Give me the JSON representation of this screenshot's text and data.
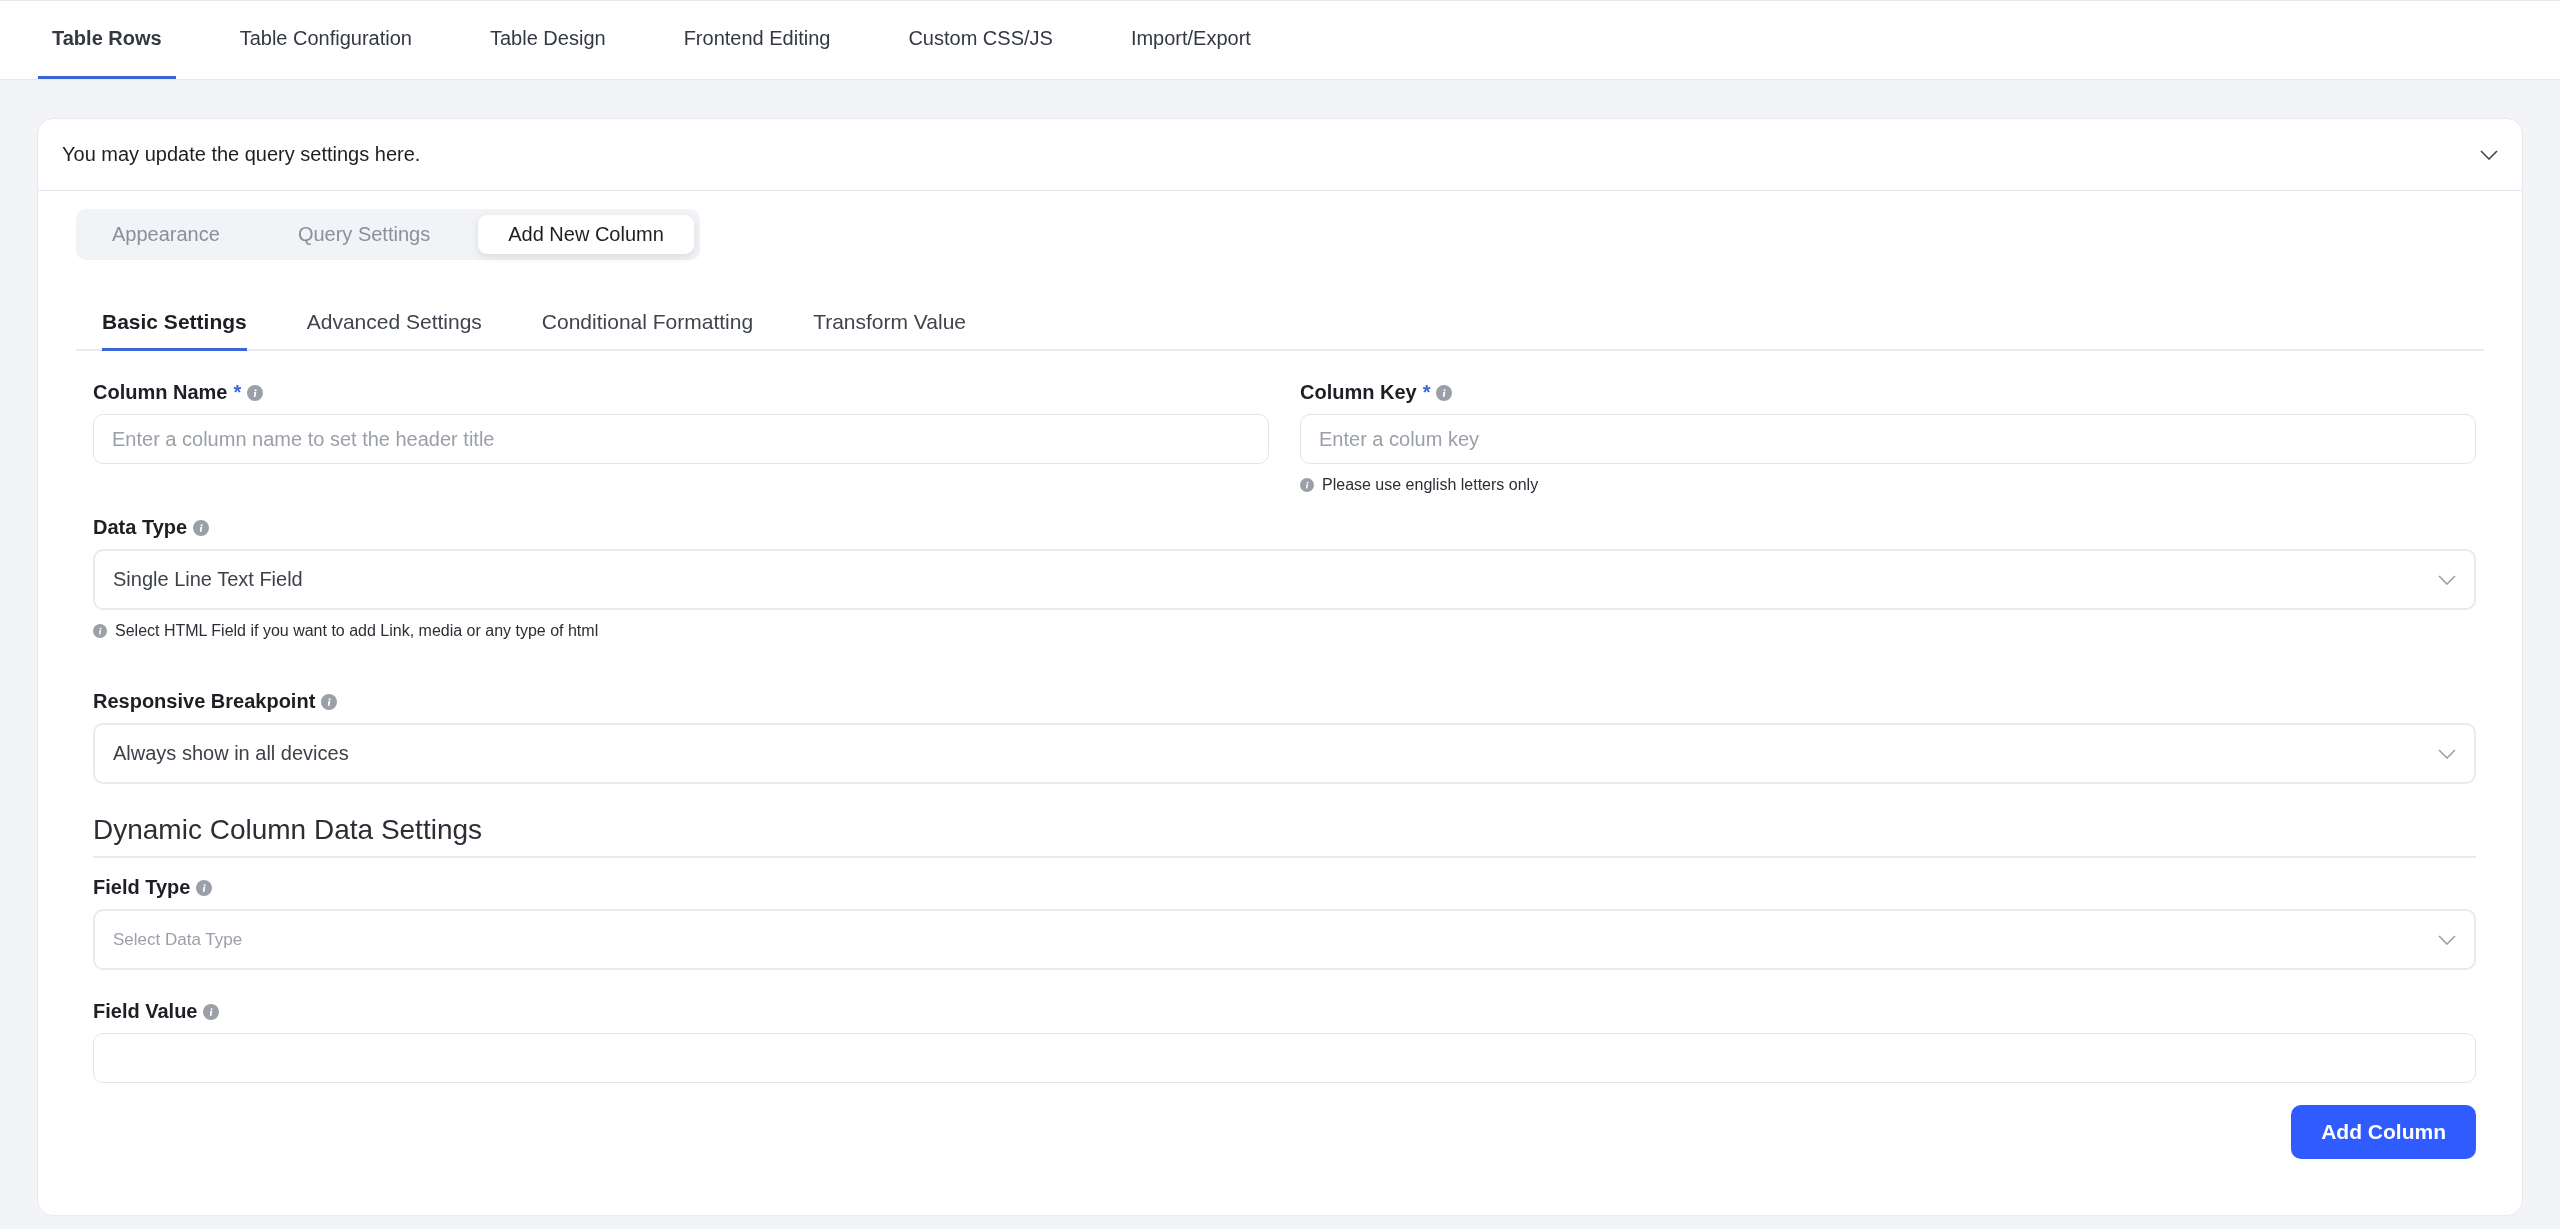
{
  "main_tabs": [
    {
      "label": "Table Rows",
      "selected": true
    },
    {
      "label": "Table Configuration",
      "selected": false
    },
    {
      "label": "Table Design",
      "selected": false
    },
    {
      "label": "Frontend Editing",
      "selected": false
    },
    {
      "label": "Custom CSS/JS",
      "selected": false
    },
    {
      "label": "Import/Export",
      "selected": false
    }
  ],
  "panel": {
    "title": "You may update the query settings here.",
    "segment_tabs": [
      {
        "label": "Appearance",
        "selected": false
      },
      {
        "label": "Query Settings",
        "selected": false
      },
      {
        "label": "Add New Column",
        "selected": true
      }
    ],
    "sub_tabs": [
      {
        "label": "Basic Settings",
        "selected": true
      },
      {
        "label": "Advanced Settings",
        "selected": false
      },
      {
        "label": "Conditional Formatting",
        "selected": false
      },
      {
        "label": "Transform Value",
        "selected": false
      }
    ],
    "row_fields": [
      {
        "kind": "text",
        "label": "Column Name",
        "mark": "*",
        "placeholder": "Enter a column name to set the header title"
      },
      {
        "kind": "text",
        "label": "Column Key",
        "mark": "*",
        "placeholder": "Enter a colum key",
        "hint": "Please use english letters only"
      }
    ],
    "fields": [
      {
        "kind": "select",
        "label": "Data Type",
        "value": "Single Line Text Field",
        "hint": "Select HTML Field if you want to add Link, media or any type of html"
      },
      {
        "kind": "select",
        "label": "Responsive Breakpoint",
        "value": "Always show in all devices"
      }
    ],
    "section_title": "Dynamic Column Data Settings",
    "section_fields": [
      {
        "kind": "select",
        "label": "Field Type",
        "placeholder": "Select Data Type"
      },
      {
        "kind": "text",
        "label": "Field Value"
      }
    ],
    "submit": "Add Column"
  }
}
